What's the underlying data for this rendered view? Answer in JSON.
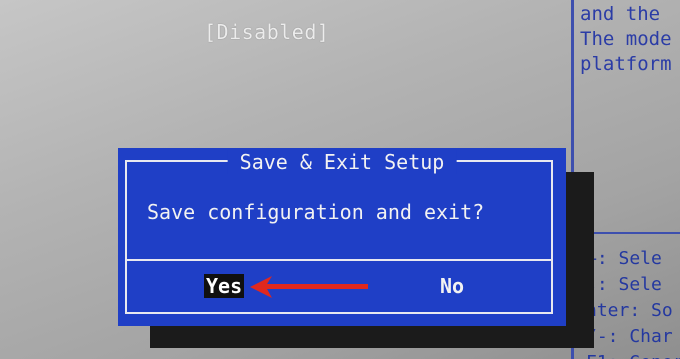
{
  "background_setting": {
    "value": "[Disabled]"
  },
  "help_panel": {
    "lines": [
      "and the",
      "The mode",
      "platform"
    ]
  },
  "key_legend": {
    "lines": [
      "←: Sele",
      "↓: Sele",
      "nter: So",
      "/-: Char",
      "F1: Gener"
    ]
  },
  "dialog": {
    "title": "Save & Exit Setup",
    "message": "Save configuration and exit?",
    "yes_label": "Yes",
    "no_label": "No",
    "selected": "Yes"
  },
  "colors": {
    "dialog_bg": "#1f3fc6",
    "frame": "#e8e8f0",
    "help_text": "#2b3ca6",
    "arrow": "#e0281e",
    "highlight": "#101010"
  },
  "icons": {
    "pointer": "red-arrow-icon"
  }
}
